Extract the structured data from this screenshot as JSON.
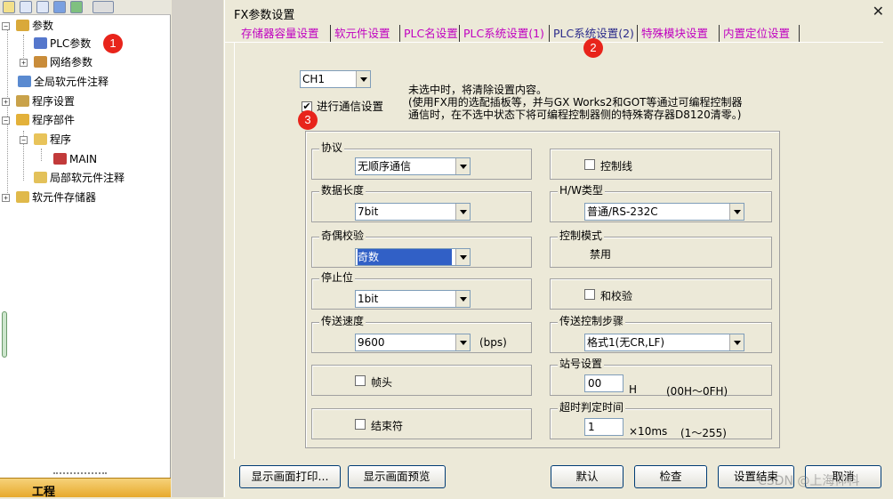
{
  "tree": {
    "items": [
      {
        "label": "参数"
      },
      {
        "label": "PLC参数"
      },
      {
        "label": "网络参数"
      },
      {
        "label": "全局软元件注释"
      },
      {
        "label": "程序设置"
      },
      {
        "label": "程序部件"
      },
      {
        "label": "程序"
      },
      {
        "label": "MAIN"
      },
      {
        "label": "局部软元件注释"
      },
      {
        "label": "软元件存储器"
      }
    ],
    "bottom_label": "工程"
  },
  "badges": [
    "1",
    "2",
    "3"
  ],
  "dialog": {
    "title": "FX参数设置",
    "close": "✕",
    "tabs": [
      {
        "label": "存储器容量设置"
      },
      {
        "label": "软元件设置"
      },
      {
        "label": "PLC名设置"
      },
      {
        "label": "PLC系统设置(1)"
      },
      {
        "label": "PLC系统设置(2)",
        "active": true
      },
      {
        "label": "特殊模块设置"
      },
      {
        "label": "内置定位设置"
      }
    ],
    "channel": "CH1",
    "comm_setting": {
      "checked": true,
      "label": "进行通信设置"
    },
    "note_lines": [
      "未选中时，将清除设置内容。",
      "(使用FX用的选配插板等，并与GX Works2和GOT等通过可编程控制器",
      "通信时，在不选中状态下将可编程控制器侧的特殊寄存器D8120清零。)"
    ],
    "protocol": {
      "label": "协议",
      "value": "无顺序通信"
    },
    "data_length": {
      "label": "数据长度",
      "value": "7bit"
    },
    "parity": {
      "label": "奇偶校验",
      "value": "奇数"
    },
    "stop_bit": {
      "label": "停止位",
      "value": "1bit"
    },
    "baud": {
      "label": "传送速度",
      "value": "9600",
      "unit": "(bps)"
    },
    "header": {
      "label": "帧头",
      "checked": false
    },
    "terminator": {
      "label": "结束符",
      "checked": false
    },
    "control_line": {
      "label": "控制线",
      "checked": false
    },
    "hw_type": {
      "label": "H/W类型",
      "value": "普通/RS-232C"
    },
    "control_mode": {
      "label": "控制模式",
      "value": "禁用"
    },
    "sum_check": {
      "label": "和校验",
      "checked": false
    },
    "transfer_control": {
      "label": "传送控制步骤",
      "value": "格式1(无CR,LF)"
    },
    "station": {
      "label": "站号设置",
      "value": "00",
      "unit": "H",
      "range": "(00H～0FH)"
    },
    "timeout": {
      "label": "超时判定时间",
      "value": "1",
      "unit": "×10ms",
      "range": "(1～255)"
    },
    "buttons": {
      "print": "显示画面打印...",
      "preview": "显示画面预览",
      "default": "默认",
      "check": "检查",
      "finish": "设置结束",
      "cancel": "取消"
    }
  },
  "watermark": "CSDN @上海仰科"
}
